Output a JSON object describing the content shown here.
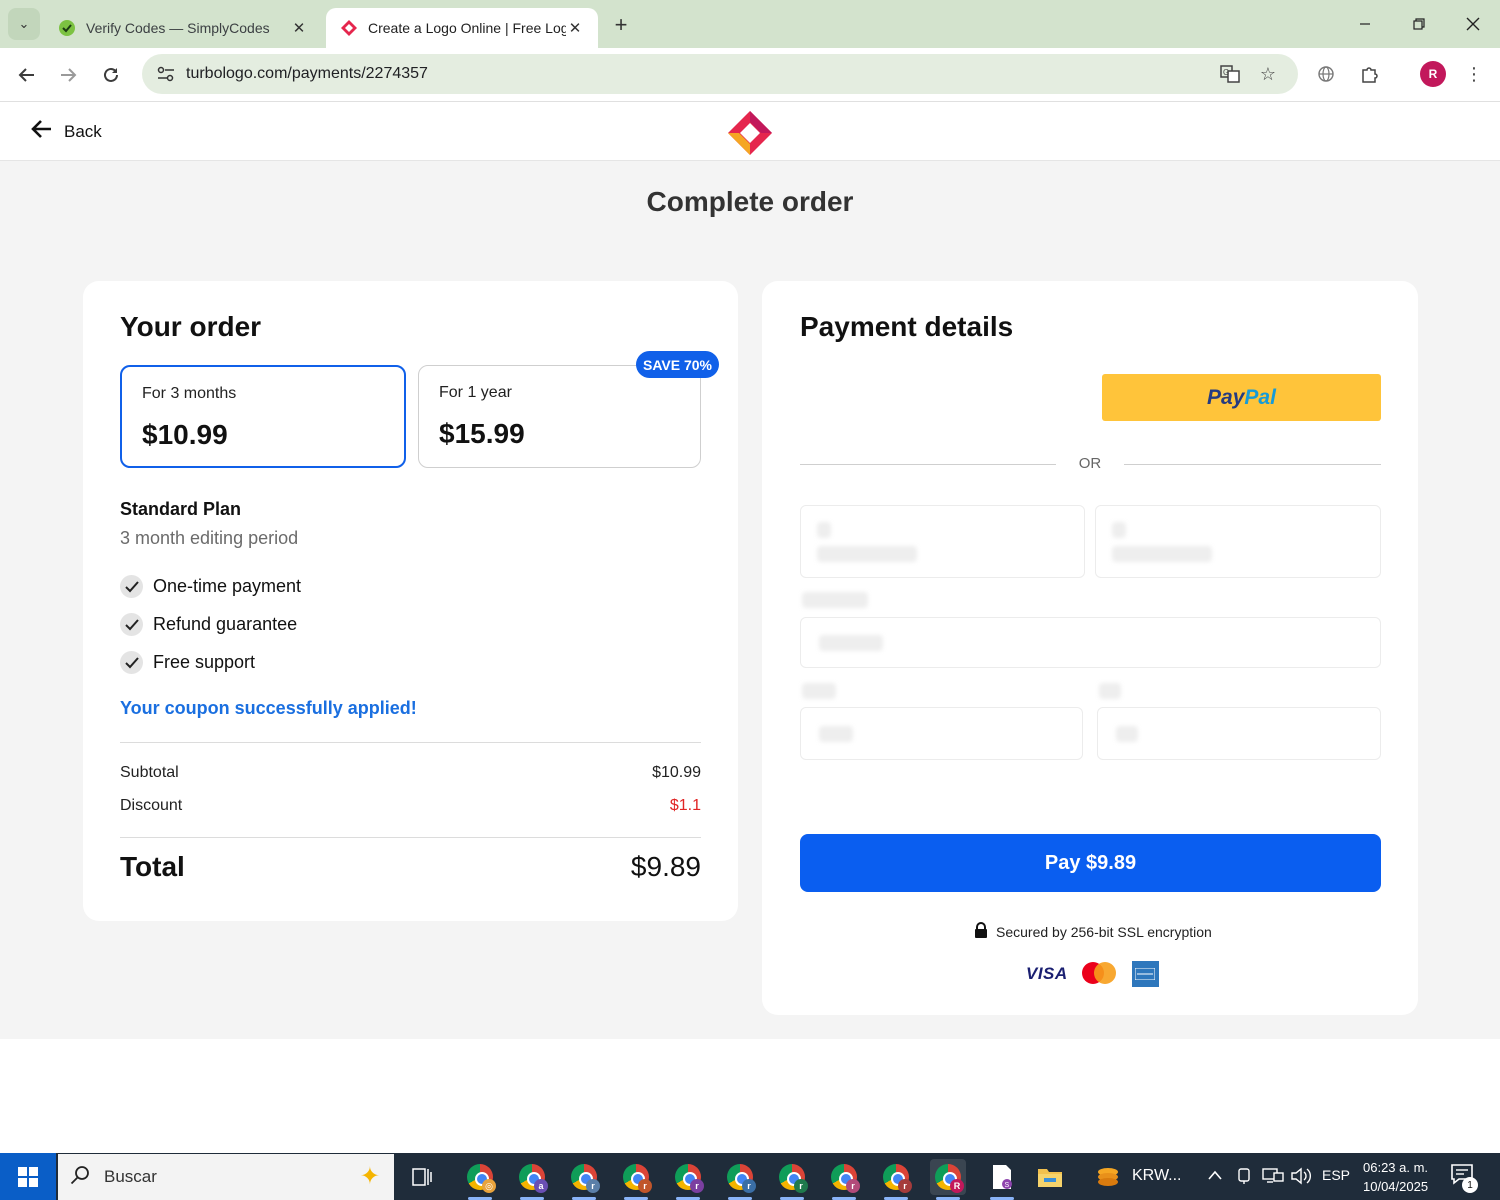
{
  "browser": {
    "tabs": [
      {
        "title": "Verify Codes — SimplyCodes",
        "active": false
      },
      {
        "title": "Create a Logo Online | Free Log",
        "active": true
      }
    ],
    "url": "turbologo.com/payments/2274357"
  },
  "header": {
    "back_label": "Back"
  },
  "page_title": "Complete order",
  "order": {
    "title": "Your order",
    "plans": [
      {
        "duration": "For 3 months",
        "price": "$10.99",
        "selected": true
      },
      {
        "duration": "For 1 year",
        "price": "$15.99",
        "selected": false,
        "badge": "SAVE 70%"
      }
    ],
    "plan_name": "Standard Plan",
    "plan_period": "3 month editing period",
    "features": [
      "One-time payment",
      "Refund guarantee",
      "Free support"
    ],
    "coupon_message": "Your coupon successfully applied!",
    "subtotal_label": "Subtotal",
    "subtotal_value": "$10.99",
    "discount_label": "Discount",
    "discount_value": "$1.1",
    "total_label": "Total",
    "total_value": "$9.89"
  },
  "payment": {
    "title": "Payment details",
    "paypal_label_1": "Pay",
    "paypal_label_2": "Pal",
    "or_label": "OR",
    "pay_button": "Pay $9.89",
    "secure_text": "Secured by 256-bit SSL encryption",
    "card_brand_visa": "VISA"
  },
  "taskbar": {
    "search_placeholder": "Buscar",
    "pinned_app_label": "KRW...",
    "language": "ESP",
    "time": "06:23 a. m.",
    "date": "10/04/2025",
    "notification_count": "1"
  },
  "colors": {
    "primary_blue": "#0a5ef0",
    "paypal_yellow": "#ffc43a",
    "discount_red": "#e02424",
    "coupon_blue": "#1a6fe0",
    "tabbar_green": "#d3e3cd"
  }
}
